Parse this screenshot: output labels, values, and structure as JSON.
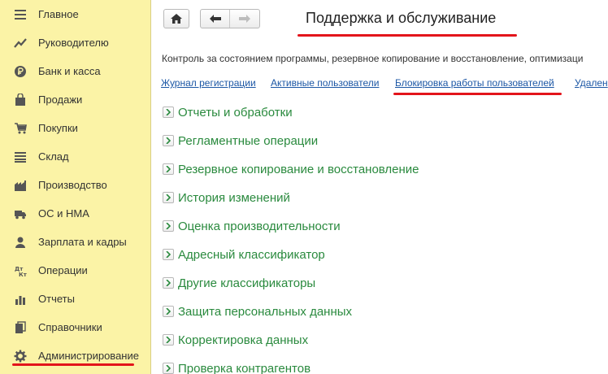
{
  "sidebar": {
    "items": [
      {
        "label": "Главное",
        "icon": "menu-lines-icon"
      },
      {
        "label": "Руководителю",
        "icon": "trend-chart-icon"
      },
      {
        "label": "Банк и касса",
        "icon": "ruble-coin-icon"
      },
      {
        "label": "Продажи",
        "icon": "shopping-bag-icon"
      },
      {
        "label": "Покупки",
        "icon": "shopping-cart-icon"
      },
      {
        "label": "Склад",
        "icon": "warehouse-list-icon"
      },
      {
        "label": "Производство",
        "icon": "factory-icon"
      },
      {
        "label": "ОС и НМА",
        "icon": "truck-icon"
      },
      {
        "label": "Зарплата и кадры",
        "icon": "person-icon"
      },
      {
        "label": "Операции",
        "icon": "debit-credit-icon"
      },
      {
        "label": "Отчеты",
        "icon": "bar-chart-icon"
      },
      {
        "label": "Справочники",
        "icon": "books-icon"
      },
      {
        "label": "Администрирование",
        "icon": "gear-icon"
      }
    ],
    "active_item": "Администрирование"
  },
  "header": {
    "title": "Поддержка и обслуживание"
  },
  "main": {
    "description": "Контроль за состоянием программы, резервное копирование и восстановление, оптимизаци",
    "links": [
      "Журнал регистрации",
      "Активные пользователи",
      "Блокировка работы пользователей",
      "Удален"
    ],
    "sections": [
      "Отчеты и обработки",
      "Регламентные операции",
      "Резервное копирование и восстановление",
      "История изменений",
      "Оценка производительности",
      "Адресный классификатор",
      "Другие классификаторы",
      "Защита персональных данных",
      "Корректировка данных",
      "Проверка контрагентов"
    ]
  },
  "colors": {
    "sidebar_bg": "#fbf3a6",
    "link": "#1c57a5",
    "section_text": "#2a8a3e",
    "highlight": "#e3141b"
  }
}
